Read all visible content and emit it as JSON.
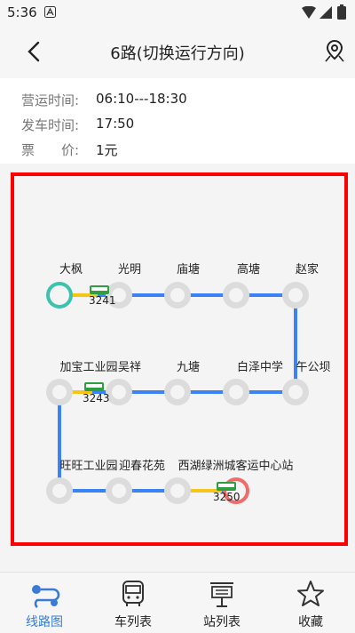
{
  "status_bar": {
    "time": "5:36"
  },
  "header": {
    "title": "6路(切换运行方向)"
  },
  "info": {
    "hours_label": "营运时间:",
    "hours_value": "06:10---18:30",
    "departure_label": "发车时间:",
    "departure_value": "17:50",
    "fare_label": "票　　价:",
    "fare_value": "1元"
  },
  "route": {
    "stops": [
      "大枫",
      "光明",
      "庙塘",
      "高塘",
      "赵家",
      "午公坝",
      "白泽中学",
      "九塘",
      "吴祥",
      "加宝工业园",
      "旺旺工业园",
      "迎春花苑",
      "西湖绿洲城",
      "客运中心站"
    ],
    "buses": [
      "3241",
      "3243",
      "3250"
    ],
    "colors": {
      "line": "#3b82f6",
      "passed": "#f5c518",
      "start": "#3cc3ad",
      "end": "#f26b6b",
      "stop": "#dcdcdc"
    }
  },
  "tabs": [
    {
      "label": "线路图",
      "icon": "route-map-icon",
      "active": true
    },
    {
      "label": "车列表",
      "icon": "bus-icon",
      "active": false
    },
    {
      "label": "站列表",
      "icon": "bus-stop-icon",
      "active": false
    },
    {
      "label": "收藏",
      "icon": "star-icon",
      "active": false
    }
  ]
}
